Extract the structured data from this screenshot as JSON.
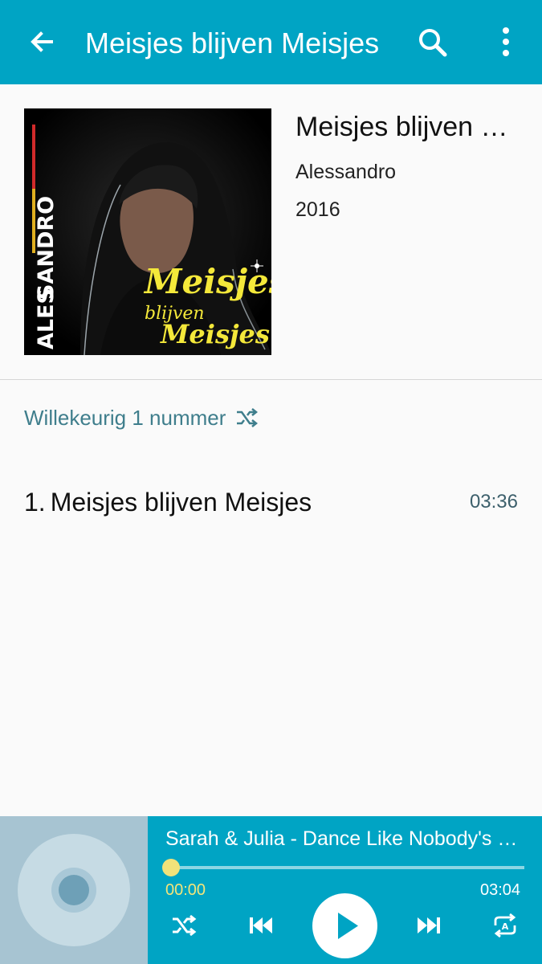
{
  "app_bar": {
    "title": "Meisjes blijven Meisjes",
    "icons": {
      "back": "arrow-back-icon",
      "search": "search-icon",
      "more": "more-vert-icon"
    }
  },
  "album": {
    "title": "Meisjes blijven Meisjes",
    "artist": "Alessandro",
    "year": "2016",
    "cover_artist_text": "ALESSANDRO",
    "cover_title_text": [
      "Meisjes",
      "blijven",
      "Meisjes"
    ]
  },
  "shuffle": {
    "label": "Willekeurig 1 nummer",
    "icon": "shuffle-icon"
  },
  "tracks": [
    {
      "number": "1.",
      "title": "Meisjes blijven Meisjes",
      "duration": "03:36"
    }
  ],
  "mini_player": {
    "song": "Sarah & Julia - Dance Like Nobody's Watching",
    "elapsed": "00:00",
    "total": "03:04",
    "progress": 0,
    "icons": [
      "shuffle-icon",
      "previous-icon",
      "play-icon",
      "next-icon",
      "repeat-a-icon"
    ]
  },
  "colors": {
    "primary": "#00a4c4",
    "accent_yellow": "#f1e27a",
    "link_teal": "#3f7e8c"
  }
}
